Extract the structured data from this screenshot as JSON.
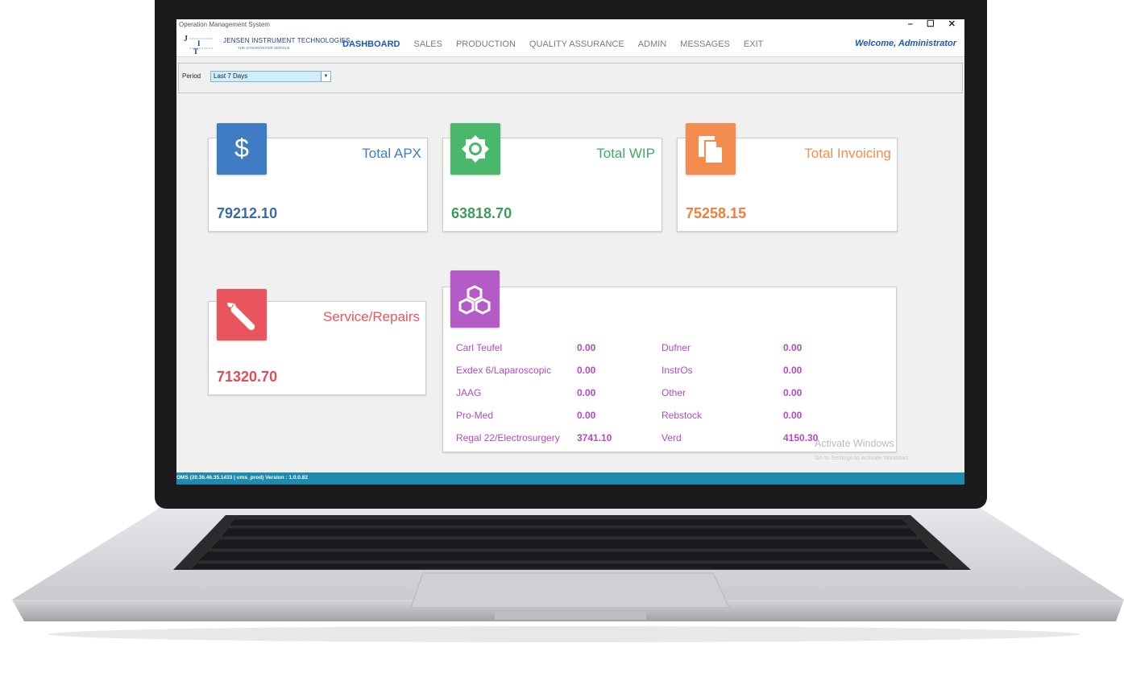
{
  "app": {
    "title": "Operation Management System",
    "window_controls": "– ☐ ✕",
    "logo_name": "JENSEN INSTRUMENT TECHNOLOGIES",
    "logo_tagline": "THE SYNONYM FOR SERVICE",
    "welcome": "Welcome, Administrator"
  },
  "nav": {
    "items": [
      {
        "label": "DASHBOARD",
        "active": true
      },
      {
        "label": "SALES"
      },
      {
        "label": "PRODUCTION"
      },
      {
        "label": "QUALITY ASSURANCE"
      },
      {
        "label": "ADMIN"
      },
      {
        "label": "MESSAGES"
      },
      {
        "label": "EXIT"
      }
    ]
  },
  "filter": {
    "label": "Period",
    "value": "Last 7 Days"
  },
  "cards": {
    "apx": {
      "title": "Total APX",
      "value": "79212.10",
      "icon": "dollar-icon",
      "color": "#3f7cc4"
    },
    "wip": {
      "title": "Total WIP",
      "value": "63818.70",
      "icon": "gear-icon",
      "color": "#49b86a"
    },
    "invoicing": {
      "title": "Total Invoicing",
      "value": "75258.15",
      "icon": "document-icon",
      "color": "#f28d4f"
    },
    "service": {
      "title": "Service/Repairs",
      "value": "71320.70",
      "icon": "wrench-icon",
      "color": "#e9555d"
    },
    "manufacturers": {
      "icon": "cubes-icon",
      "color": "#b55bc7",
      "left": [
        {
          "name": "Carl Teufel",
          "value": "0.00"
        },
        {
          "name": "Exdex 6/Laparoscopic",
          "value": "0.00"
        },
        {
          "name": "JAAG",
          "value": "0.00"
        },
        {
          "name": "Pro-Med",
          "value": "0.00"
        },
        {
          "name": "Regal 22/Electrosurgery",
          "value": "3741.10"
        }
      ],
      "right": [
        {
          "name": "Dufner",
          "value": "0.00"
        },
        {
          "name": "InstrOs",
          "value": "0.00"
        },
        {
          "name": "Other",
          "value": "0.00"
        },
        {
          "name": "Rebstock",
          "value": "0.00"
        },
        {
          "name": "Verd",
          "value": "4150.30"
        }
      ]
    }
  },
  "status_bar": "OMS (20.36.46.35.1433 | oms_prod) Version : 1.0.0.82",
  "watermark": {
    "title": "Activate Windows",
    "subtitle": "Go to Settings to activate Windows."
  }
}
